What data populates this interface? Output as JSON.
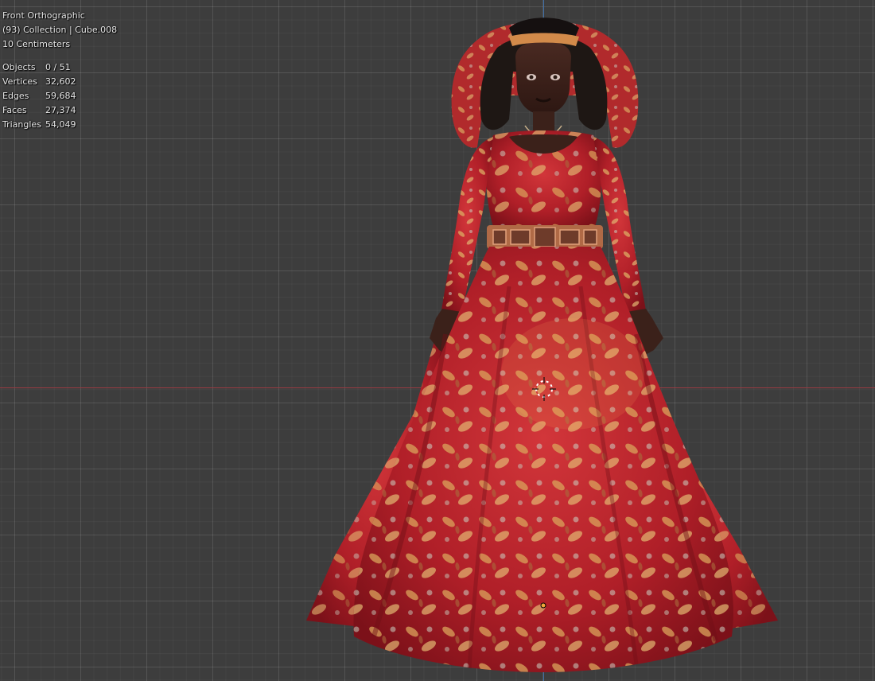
{
  "viewport": {
    "view_name": "Front Orthographic",
    "collection_info": "(93) Collection | Cube.008",
    "grid_scale": "10 Centimeters"
  },
  "stats": [
    {
      "label": "Objects",
      "value": "0 / 51"
    },
    {
      "label": "Vertices",
      "value": "32,602"
    },
    {
      "label": "Edges",
      "value": "59,684"
    },
    {
      "label": "Faces",
      "value": "27,374"
    },
    {
      "label": "Triangles",
      "value": "54,049"
    }
  ],
  "colors": {
    "background": "#3d3d3d",
    "x_axis": "#9a3b43",
    "z_axis": "#3f6fa8",
    "dress_red": "#b8202a",
    "pattern_gold": "#d9a35a"
  },
  "icons": [
    "3d-cursor-icon",
    "object-origin-icon"
  ]
}
